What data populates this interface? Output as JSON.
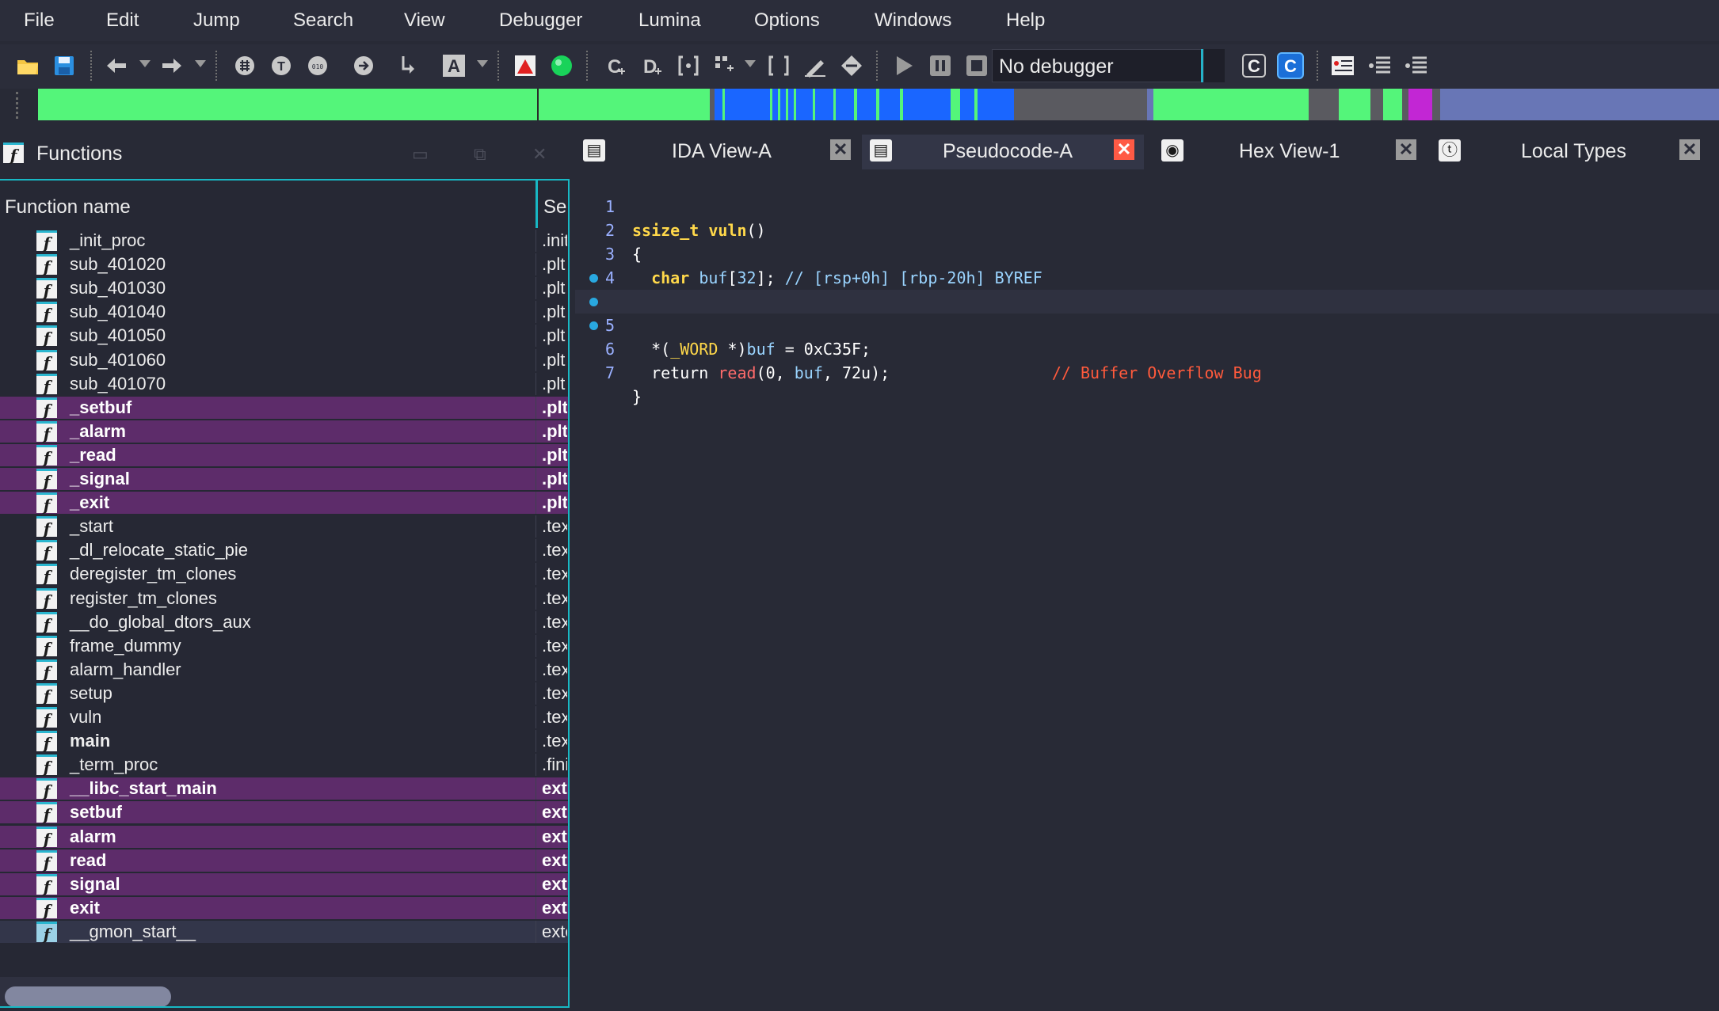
{
  "menu": [
    "File",
    "Edit",
    "Jump",
    "Search",
    "View",
    "Debugger",
    "Lumina",
    "Options",
    "Windows",
    "Help"
  ],
  "toolbar": {
    "debugger_select": "No debugger",
    "icons": [
      "open-folder-icon",
      "save-icon",
      "back-arrow-icon",
      "forward-arrow-icon",
      "graph-icon",
      "text-icon",
      "hex-icon",
      "export-icon",
      "step-into-icon",
      "string-icon",
      "flag-icon",
      "green-circle-icon",
      "code-icon",
      "data-icon",
      "struct-icon",
      "array-icon",
      "undefined-icon",
      "rename-icon",
      "diamond-icon",
      "play-icon",
      "pause-icon",
      "stop-icon",
      "decompile-icon",
      "decompile-active-icon",
      "list-icon",
      "list-tree-icon",
      "list-tree-2-icon"
    ]
  },
  "functions_panel": {
    "title": "Functions",
    "columns": {
      "name": "Function name",
      "segment": "Segment"
    },
    "rows": [
      {
        "name": "_init_proc",
        "seg": ".init",
        "style": "normal"
      },
      {
        "name": "sub_401020",
        "seg": ".plt",
        "style": "normal"
      },
      {
        "name": "sub_401030",
        "seg": ".plt",
        "style": "normal"
      },
      {
        "name": "sub_401040",
        "seg": ".plt",
        "style": "normal"
      },
      {
        "name": "sub_401050",
        "seg": ".plt",
        "style": "normal"
      },
      {
        "name": "sub_401060",
        "seg": ".plt",
        "style": "normal"
      },
      {
        "name": "sub_401070",
        "seg": ".plt",
        "style": "normal"
      },
      {
        "name": "_setbuf",
        "seg": ".plt.sec",
        "style": "hl"
      },
      {
        "name": "_alarm",
        "seg": ".plt.sec",
        "style": "hl"
      },
      {
        "name": "_read",
        "seg": ".plt.sec",
        "style": "hl"
      },
      {
        "name": "_signal",
        "seg": ".plt.sec",
        "style": "hl"
      },
      {
        "name": "_exit",
        "seg": ".plt.sec",
        "style": "hl"
      },
      {
        "name": "_start",
        "seg": ".text",
        "style": "normal"
      },
      {
        "name": "_dl_relocate_static_pie",
        "seg": ".text",
        "style": "normal"
      },
      {
        "name": "deregister_tm_clones",
        "seg": ".text",
        "style": "normal"
      },
      {
        "name": "register_tm_clones",
        "seg": ".text",
        "style": "normal"
      },
      {
        "name": "__do_global_dtors_aux",
        "seg": ".text",
        "style": "normal"
      },
      {
        "name": "frame_dummy",
        "seg": ".text",
        "style": "normal"
      },
      {
        "name": "alarm_handler",
        "seg": ".text",
        "style": "normal"
      },
      {
        "name": "setup",
        "seg": ".text",
        "style": "normal"
      },
      {
        "name": "vuln",
        "seg": ".text",
        "style": "normal"
      },
      {
        "name": "main",
        "seg": ".text",
        "style": "bold"
      },
      {
        "name": "_term_proc",
        "seg": ".fini",
        "style": "normal"
      },
      {
        "name": "__libc_start_main",
        "seg": "extern",
        "style": "hl"
      },
      {
        "name": "setbuf",
        "seg": "extern",
        "style": "hl"
      },
      {
        "name": "alarm",
        "seg": "extern",
        "style": "hl"
      },
      {
        "name": "read",
        "seg": "extern",
        "style": "hl"
      },
      {
        "name": "signal",
        "seg": "extern",
        "style": "hl"
      },
      {
        "name": "exit",
        "seg": "extern",
        "style": "hl"
      },
      {
        "name": "__gmon_start__",
        "seg": "extern",
        "style": "sel"
      }
    ]
  },
  "tabs": [
    {
      "label": "IDA View-A",
      "icon": "graph-view-icon",
      "active": false
    },
    {
      "label": "Pseudocode-A",
      "icon": "pseudocode-icon",
      "active": true
    },
    {
      "label": "Hex View-1",
      "icon": "hex-view-icon",
      "active": false
    },
    {
      "label": "Local Types",
      "icon": "local-types-icon",
      "active": false
    }
  ],
  "pseudocode": {
    "lines": [
      {
        "num": "1",
        "bp": false,
        "text": "ssize_t vuln()"
      },
      {
        "num": "2",
        "bp": false,
        "text": "{"
      },
      {
        "num": "3",
        "bp": false,
        "text": "  char buf[32]; // [rsp+0h] [rbp-20h] BYREF"
      },
      {
        "num": "4",
        "bp": false,
        "text": ""
      },
      {
        "num": "5",
        "bp": true,
        "text": "  *(_WORD *)buf = 0xC35F;"
      },
      {
        "num": "6",
        "bp": true,
        "text": "  return read(0, buf, 72u);                 // Buffer Overflow Bug"
      },
      {
        "num": "7",
        "bp": true,
        "text": "}"
      }
    ]
  },
  "colors": {
    "accent": "#18b8c4",
    "highlight_row": "#5d2c6a",
    "tab_close_active": "#ff5a45",
    "nav_code": "#54f57a",
    "nav_blue": "#1a66ff",
    "nav_grey": "#5a5a60",
    "nav_magenta": "#c226d4",
    "nav_default": "#6876b6"
  }
}
